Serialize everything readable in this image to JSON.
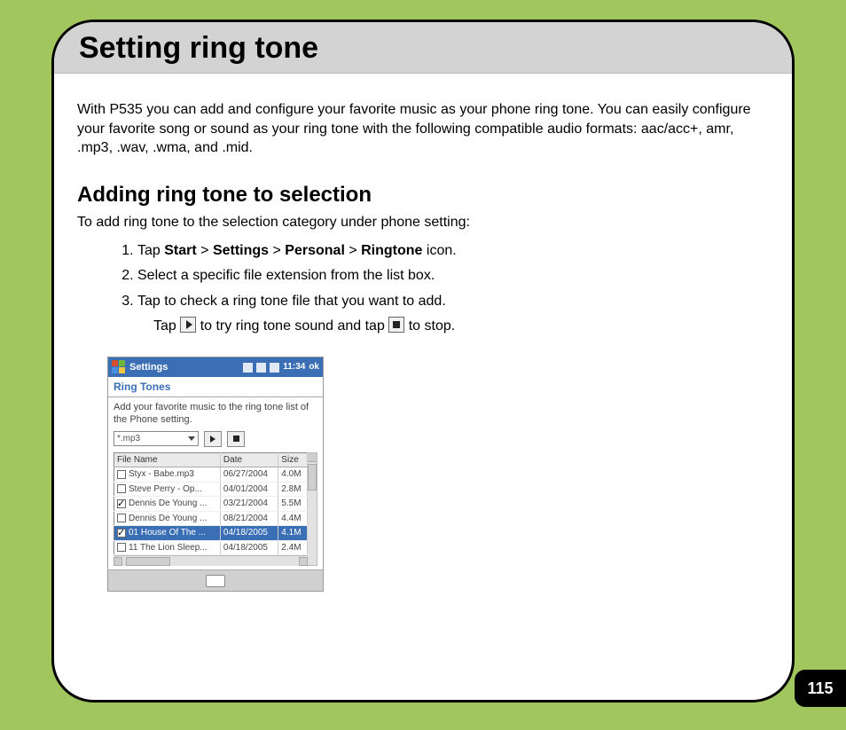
{
  "page": {
    "title": "Setting ring tone",
    "number": "115"
  },
  "intro": "With P535 you can add and configure your favorite music as your phone ring tone. You can easily configure your favorite song or sound as your ring tone with the following compatible audio formats: aac/acc+, amr, .mp3, .wav, .wma, and .mid.",
  "section": {
    "heading": "Adding ring tone to selection",
    "intro": "To add ring tone to the selection category under phone setting:",
    "steps": {
      "s1": {
        "prefix": "Tap ",
        "b1": "Start",
        "sep": " > ",
        "b2": "Settings",
        "b3": "Personal",
        "b4": "Ringtone",
        "suffix": " icon."
      },
      "s2": "Select a specific file extension from the list box.",
      "s3": "Tap to check a ring tone file that you want to add.",
      "s3_sub": {
        "pre": "Tap ",
        "mid": " to try ring tone sound and tap ",
        "post": " to stop."
      }
    }
  },
  "screenshot": {
    "topbar": {
      "title": "Settings",
      "time": "11:34",
      "ok": "ok"
    },
    "tab": "Ring Tones",
    "desc": "Add your favorite music to the ring tone list of the Phone setting.",
    "combo_value": "*.mp3",
    "columns": {
      "c1": "File Name",
      "c2": "Date",
      "c3": "Size"
    },
    "rows": [
      {
        "checked": false,
        "name": "Styx - Babe.mp3",
        "date": "06/27/2004",
        "size": "4.0M",
        "selected": false
      },
      {
        "checked": false,
        "name": "Steve Perry - Op...",
        "date": "04/01/2004",
        "size": "2.8M",
        "selected": false
      },
      {
        "checked": true,
        "name": "Dennis De Young ...",
        "date": "03/21/2004",
        "size": "5.5M",
        "selected": false
      },
      {
        "checked": false,
        "name": "Dennis De Young ...",
        "date": "08/21/2004",
        "size": "4.4M",
        "selected": false
      },
      {
        "checked": true,
        "name": "01 House Of The ...",
        "date": "04/18/2005",
        "size": "4.1M",
        "selected": true
      },
      {
        "checked": false,
        "name": "11 The Lion Sleep...",
        "date": "04/18/2005",
        "size": "2.4M",
        "selected": false
      }
    ]
  }
}
